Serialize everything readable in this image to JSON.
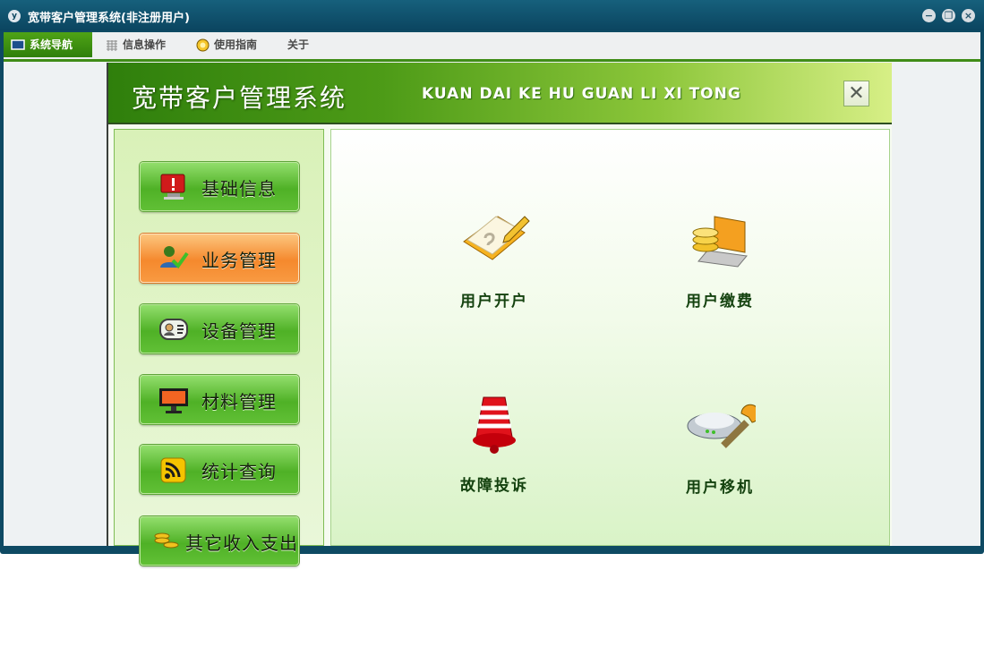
{
  "window": {
    "title": "宽带客户管理系统(非注册用户)"
  },
  "menu": {
    "items": [
      {
        "label": "系统导航",
        "icon": "monitor-icon"
      },
      {
        "label": "信息操作",
        "icon": "grid-icon"
      },
      {
        "label": "使用指南",
        "icon": "help-icon"
      },
      {
        "label": "关于"
      }
    ]
  },
  "banner": {
    "title": "宽带客户管理系统",
    "subtitle": "KUAN DAI KE HU GUAN LI XI TONG"
  },
  "nav": {
    "items": [
      {
        "label": "基础信息",
        "icon": "computer-alert-icon"
      },
      {
        "label": "业务管理",
        "icon": "user-check-icon"
      },
      {
        "label": "设备管理",
        "icon": "contact-card-icon"
      },
      {
        "label": "材料管理",
        "icon": "monitor-icon"
      },
      {
        "label": "统计查询",
        "icon": "rss-icon"
      },
      {
        "label": "其它收入支出",
        "icon": "coins-icon"
      }
    ]
  },
  "functions": [
    {
      "label": "用户开户",
      "icon": "notebook-pencil-icon"
    },
    {
      "label": "用户缴费",
      "icon": "coins-laptop-icon"
    },
    {
      "label": "故障投诉",
      "icon": "bell-icon"
    },
    {
      "label": "用户移机",
      "icon": "router-wrench-icon"
    }
  ]
}
